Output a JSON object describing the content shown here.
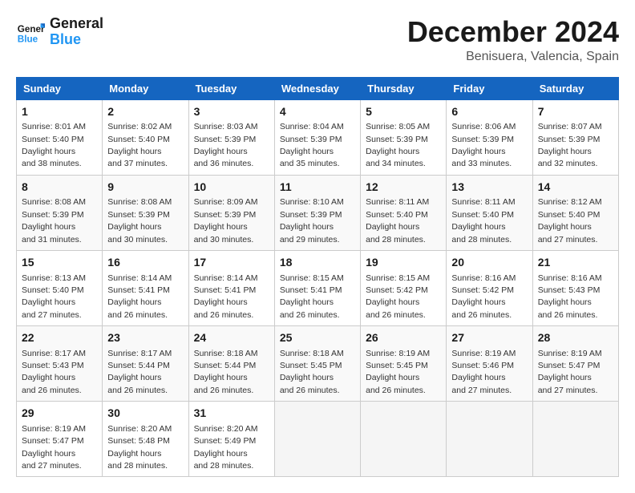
{
  "logo": {
    "brand": "General",
    "brand2": "Blue"
  },
  "title": "December 2024",
  "subtitle": "Benisuera, Valencia, Spain",
  "days_of_week": [
    "Sunday",
    "Monday",
    "Tuesday",
    "Wednesday",
    "Thursday",
    "Friday",
    "Saturday"
  ],
  "weeks": [
    [
      {
        "day": "1",
        "sunrise": "8:01 AM",
        "sunset": "5:40 PM",
        "daylight": "9 hours and 38 minutes."
      },
      {
        "day": "2",
        "sunrise": "8:02 AM",
        "sunset": "5:40 PM",
        "daylight": "9 hours and 37 minutes."
      },
      {
        "day": "3",
        "sunrise": "8:03 AM",
        "sunset": "5:39 PM",
        "daylight": "9 hours and 36 minutes."
      },
      {
        "day": "4",
        "sunrise": "8:04 AM",
        "sunset": "5:39 PM",
        "daylight": "9 hours and 35 minutes."
      },
      {
        "day": "5",
        "sunrise": "8:05 AM",
        "sunset": "5:39 PM",
        "daylight": "9 hours and 34 minutes."
      },
      {
        "day": "6",
        "sunrise": "8:06 AM",
        "sunset": "5:39 PM",
        "daylight": "9 hours and 33 minutes."
      },
      {
        "day": "7",
        "sunrise": "8:07 AM",
        "sunset": "5:39 PM",
        "daylight": "9 hours and 32 minutes."
      }
    ],
    [
      {
        "day": "8",
        "sunrise": "8:08 AM",
        "sunset": "5:39 PM",
        "daylight": "9 hours and 31 minutes."
      },
      {
        "day": "9",
        "sunrise": "8:08 AM",
        "sunset": "5:39 PM",
        "daylight": "9 hours and 30 minutes."
      },
      {
        "day": "10",
        "sunrise": "8:09 AM",
        "sunset": "5:39 PM",
        "daylight": "9 hours and 30 minutes."
      },
      {
        "day": "11",
        "sunrise": "8:10 AM",
        "sunset": "5:39 PM",
        "daylight": "9 hours and 29 minutes."
      },
      {
        "day": "12",
        "sunrise": "8:11 AM",
        "sunset": "5:40 PM",
        "daylight": "9 hours and 28 minutes."
      },
      {
        "day": "13",
        "sunrise": "8:11 AM",
        "sunset": "5:40 PM",
        "daylight": "9 hours and 28 minutes."
      },
      {
        "day": "14",
        "sunrise": "8:12 AM",
        "sunset": "5:40 PM",
        "daylight": "9 hours and 27 minutes."
      }
    ],
    [
      {
        "day": "15",
        "sunrise": "8:13 AM",
        "sunset": "5:40 PM",
        "daylight": "9 hours and 27 minutes."
      },
      {
        "day": "16",
        "sunrise": "8:14 AM",
        "sunset": "5:41 PM",
        "daylight": "9 hours and 26 minutes."
      },
      {
        "day": "17",
        "sunrise": "8:14 AM",
        "sunset": "5:41 PM",
        "daylight": "9 hours and 26 minutes."
      },
      {
        "day": "18",
        "sunrise": "8:15 AM",
        "sunset": "5:41 PM",
        "daylight": "9 hours and 26 minutes."
      },
      {
        "day": "19",
        "sunrise": "8:15 AM",
        "sunset": "5:42 PM",
        "daylight": "9 hours and 26 minutes."
      },
      {
        "day": "20",
        "sunrise": "8:16 AM",
        "sunset": "5:42 PM",
        "daylight": "9 hours and 26 minutes."
      },
      {
        "day": "21",
        "sunrise": "8:16 AM",
        "sunset": "5:43 PM",
        "daylight": "9 hours and 26 minutes."
      }
    ],
    [
      {
        "day": "22",
        "sunrise": "8:17 AM",
        "sunset": "5:43 PM",
        "daylight": "9 hours and 26 minutes."
      },
      {
        "day": "23",
        "sunrise": "8:17 AM",
        "sunset": "5:44 PM",
        "daylight": "9 hours and 26 minutes."
      },
      {
        "day": "24",
        "sunrise": "8:18 AM",
        "sunset": "5:44 PM",
        "daylight": "9 hours and 26 minutes."
      },
      {
        "day": "25",
        "sunrise": "8:18 AM",
        "sunset": "5:45 PM",
        "daylight": "9 hours and 26 minutes."
      },
      {
        "day": "26",
        "sunrise": "8:19 AM",
        "sunset": "5:45 PM",
        "daylight": "9 hours and 26 minutes."
      },
      {
        "day": "27",
        "sunrise": "8:19 AM",
        "sunset": "5:46 PM",
        "daylight": "9 hours and 27 minutes."
      },
      {
        "day": "28",
        "sunrise": "8:19 AM",
        "sunset": "5:47 PM",
        "daylight": "9 hours and 27 minutes."
      }
    ],
    [
      {
        "day": "29",
        "sunrise": "8:19 AM",
        "sunset": "5:47 PM",
        "daylight": "9 hours and 27 minutes."
      },
      {
        "day": "30",
        "sunrise": "8:20 AM",
        "sunset": "5:48 PM",
        "daylight": "9 hours and 28 minutes."
      },
      {
        "day": "31",
        "sunrise": "8:20 AM",
        "sunset": "5:49 PM",
        "daylight": "9 hours and 28 minutes."
      },
      null,
      null,
      null,
      null
    ]
  ]
}
